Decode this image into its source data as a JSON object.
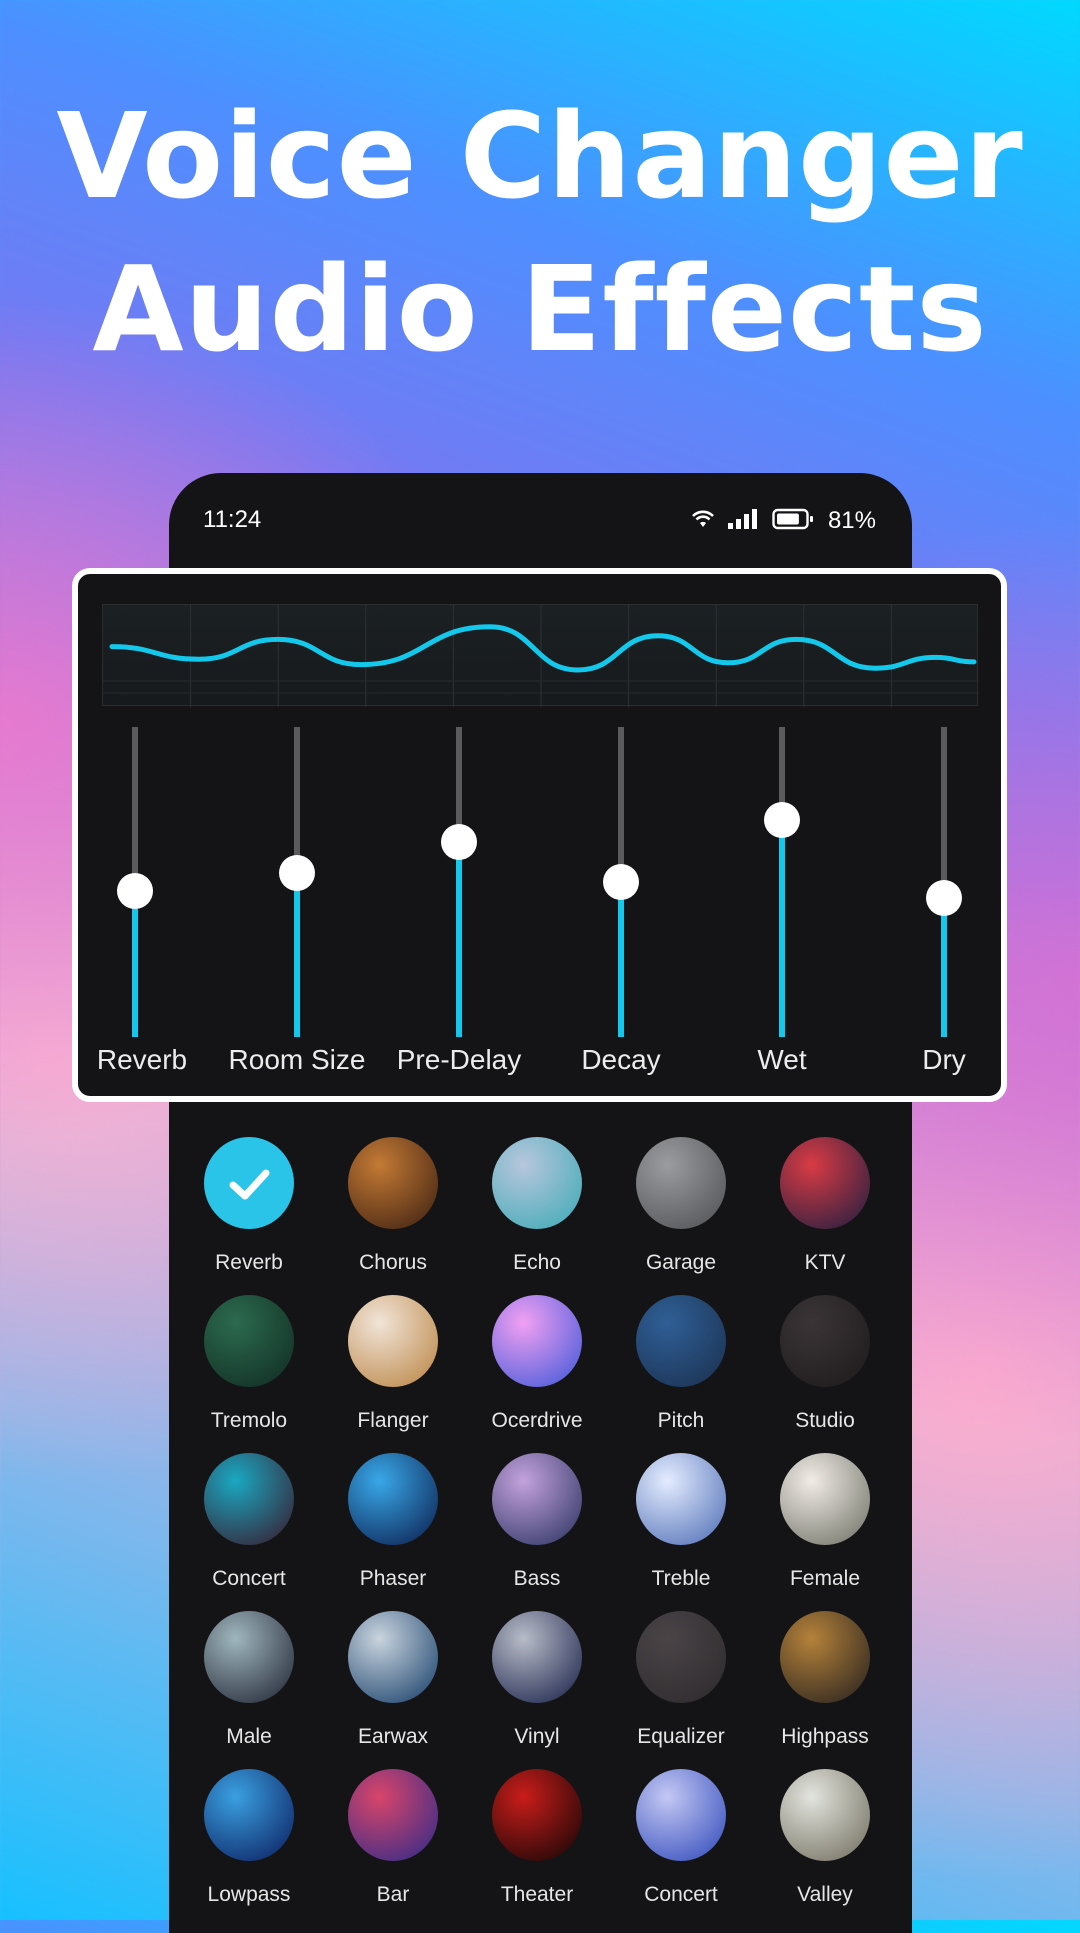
{
  "headline": {
    "line1": "Voice Changer",
    "line2": "Audio Effects"
  },
  "status_bar": {
    "time": "11:24",
    "battery_percent": "81%",
    "battery_level": 0.81,
    "icons": [
      "wifi-icon",
      "signal-icon",
      "battery-icon"
    ]
  },
  "colors": {
    "accent": "#14C8EC",
    "selected": "#29C4E8",
    "panel": "#141416",
    "track": "#5B5B5E"
  },
  "equalizer": {
    "sliders": [
      {
        "label": "Reverb",
        "value": 0.47
      },
      {
        "label": "Room Size",
        "value": 0.53
      },
      {
        "label": "Pre-Delay",
        "value": 0.63
      },
      {
        "label": "Decay",
        "value": 0.5
      },
      {
        "label": "Wet",
        "value": 0.7
      },
      {
        "label": "Dry",
        "value": 0.45
      }
    ],
    "waveform": [
      0.56,
      0.42,
      0.64,
      0.36,
      0.78,
      0.3,
      0.68,
      0.38,
      0.64,
      0.32,
      0.44,
      0.39
    ]
  },
  "effects": [
    {
      "label": "Reverb",
      "selected": true,
      "swatch": [
        "#29C4E8",
        "#29C4E8"
      ]
    },
    {
      "label": "Chorus",
      "selected": false,
      "swatch": [
        "#c47a35",
        "#3a1e10"
      ]
    },
    {
      "label": "Echo",
      "selected": false,
      "swatch": [
        "#b7c6dd",
        "#3aa9b4"
      ]
    },
    {
      "label": "Garage",
      "selected": false,
      "swatch": [
        "#9a9c9f",
        "#4c4e52"
      ]
    },
    {
      "label": "KTV",
      "selected": false,
      "swatch": [
        "#d83b44",
        "#1b1d40"
      ]
    },
    {
      "label": "Tremolo",
      "selected": false,
      "swatch": [
        "#2c6a4e",
        "#0f2a22"
      ]
    },
    {
      "label": "Flanger",
      "selected": false,
      "swatch": [
        "#f1e4d8",
        "#b8823f"
      ]
    },
    {
      "label": "Ocerdrive",
      "selected": false,
      "swatch": [
        "#f1a0f2",
        "#3a56d8"
      ]
    },
    {
      "label": "Pitch",
      "selected": false,
      "swatch": [
        "#2f5f96",
        "#1a2f4d"
      ]
    },
    {
      "label": "Studio",
      "selected": false,
      "swatch": [
        "#3a3436",
        "#1d1a1c"
      ]
    },
    {
      "label": "Concert",
      "selected": false,
      "swatch": [
        "#1aa8c2",
        "#3a1527"
      ]
    },
    {
      "label": "Phaser",
      "selected": false,
      "swatch": [
        "#39a8e8",
        "#0a1a4a"
      ]
    },
    {
      "label": "Bass",
      "selected": false,
      "swatch": [
        "#c3a2dc",
        "#27305e"
      ]
    },
    {
      "label": "Treble",
      "selected": false,
      "swatch": [
        "#e4ecff",
        "#4a6ab3"
      ]
    },
    {
      "label": "Female",
      "selected": false,
      "swatch": [
        "#f1ece6",
        "#6b6d62"
      ]
    },
    {
      "label": "Male",
      "selected": false,
      "swatch": [
        "#9fb6bd",
        "#1d2030"
      ]
    },
    {
      "label": "Earwax",
      "selected": false,
      "swatch": [
        "#c9d4de",
        "#123a66"
      ]
    },
    {
      "label": "Vinyl",
      "selected": false,
      "swatch": [
        "#b8bcc8",
        "#141c45"
      ]
    },
    {
      "label": "Equalizer",
      "selected": false,
      "swatch": [
        "#4a4447",
        "#2d2a2c"
      ]
    },
    {
      "label": "Highpass",
      "selected": false,
      "swatch": [
        "#b5823a",
        "#221e1e"
      ]
    },
    {
      "label": "Lowpass",
      "selected": false,
      "swatch": [
        "#3aa0e0",
        "#0a1a5c"
      ]
    },
    {
      "label": "Bar",
      "selected": false,
      "swatch": [
        "#d8456a",
        "#2a2a8a"
      ]
    },
    {
      "label": "Theater",
      "selected": false,
      "swatch": [
        "#c81d1a",
        "#0c0505"
      ]
    },
    {
      "label": "Concert",
      "selected": false,
      "swatch": [
        "#c4c8f4",
        "#2c46b8"
      ]
    },
    {
      "label": "Valley",
      "selected": false,
      "swatch": [
        "#e2e4de",
        "#6e6a5a"
      ]
    }
  ]
}
